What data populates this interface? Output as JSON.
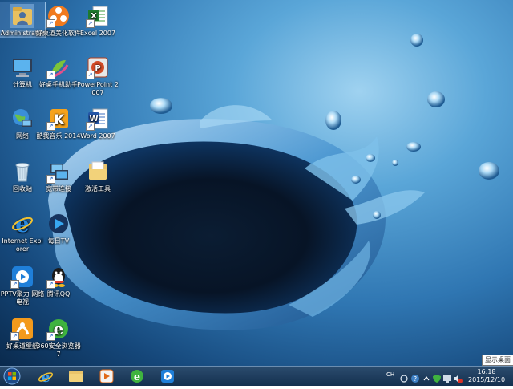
{
  "desktop_icons": [
    {
      "label": "Administrator",
      "icon": "user-folder-icon"
    },
    {
      "label": "好桌道美化软件",
      "icon": "flower-icon"
    },
    {
      "label": "Excel 2007",
      "icon": "excel-icon"
    },
    {
      "label": "计算机",
      "icon": "computer-icon"
    },
    {
      "label": "好桌手机助手",
      "icon": "phone-assistant-icon"
    },
    {
      "label": "PowerPoint 2007",
      "icon": "powerpoint-icon"
    },
    {
      "label": "网络",
      "icon": "network-icon"
    },
    {
      "label": "酷我音乐 2014",
      "icon": "kuwo-music-icon"
    },
    {
      "label": "Word 2007",
      "icon": "word-icon"
    },
    {
      "label": "回收站",
      "icon": "recycle-bin-icon"
    },
    {
      "label": "宽带连接",
      "icon": "broadband-icon"
    },
    {
      "label": "激活工具",
      "icon": "folder-icon"
    },
    {
      "label": "Internet Explorer",
      "icon": "ie-icon"
    },
    {
      "label": "每日TV",
      "icon": "tv-icon"
    },
    {
      "label": "PPTV聚力 网络电视",
      "icon": "pptv-icon"
    },
    {
      "label": "腾讯QQ",
      "icon": "qq-icon"
    },
    {
      "label": "好桌道壁纸",
      "icon": "wallpaper-icon"
    },
    {
      "label": "360安全浏览器7",
      "icon": "360-browser-icon"
    }
  ],
  "taskbar": {
    "pinned": [
      "ie-icon",
      "folder-icon",
      "media-player-icon",
      "360-browser-icon",
      "pptv-icon"
    ],
    "language": "CH"
  },
  "clock": {
    "time": "16:18",
    "date": "2015/12/10"
  },
  "tooltip": {
    "text": "显示桌面"
  }
}
